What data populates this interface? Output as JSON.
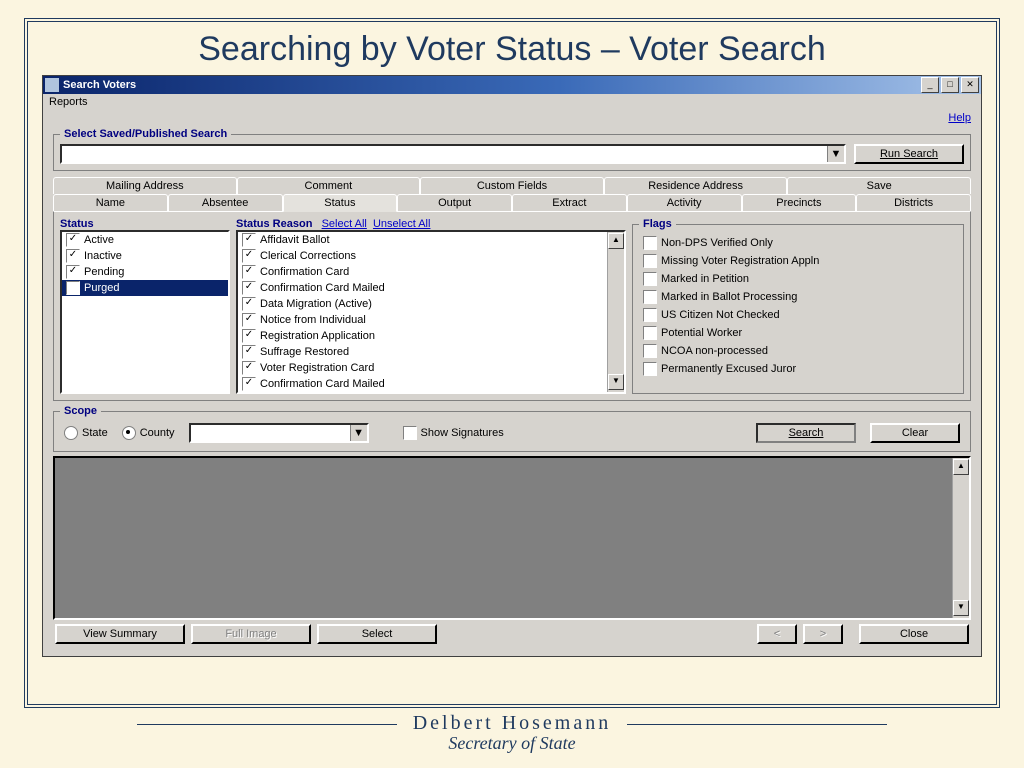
{
  "slide": {
    "title": "Searching by Voter Status – Voter Search"
  },
  "footer": {
    "name": "Delbert Hosemann",
    "office": "Secretary of State"
  },
  "window": {
    "title": "Search Voters",
    "menu": {
      "reports": "Reports"
    },
    "help": "Help",
    "saved_search": {
      "legend": "Select Saved/Published Search",
      "run": "Run Search"
    },
    "tabs_top": [
      "Mailing Address",
      "Comment",
      "Custom Fields",
      "Residence Address",
      "Save"
    ],
    "tabs_bottom": [
      "Name",
      "Absentee",
      "Status",
      "Output",
      "Extract",
      "Activity",
      "Precincts",
      "Districts"
    ],
    "active_tab": "Status",
    "status": {
      "header": "Status",
      "items": [
        {
          "label": "Active",
          "checked": true,
          "selected": false
        },
        {
          "label": "Inactive",
          "checked": true,
          "selected": false
        },
        {
          "label": "Pending",
          "checked": true,
          "selected": false
        },
        {
          "label": "Purged",
          "checked": true,
          "selected": true
        }
      ]
    },
    "status_reason": {
      "header": "Status Reason",
      "select_all": "Select All",
      "unselect_all": "Unselect All",
      "items": [
        "Affidavit Ballot",
        "Clerical Corrections",
        "Confirmation Card",
        "Confirmation Card Mailed",
        "Data Migration (Active)",
        "Notice from Individual",
        "Registration Application",
        "Suffrage Restored",
        "Voter Registration Card",
        "Confirmation Card Mailed"
      ]
    },
    "flags": {
      "legend": "Flags",
      "items": [
        "Non-DPS Verified Only",
        "Missing Voter Registration Appln",
        "Marked in Petition",
        "Marked in Ballot Processing",
        "US Citizen Not Checked",
        "Potential Worker",
        "NCOA non-processed",
        "Permanently Excused Juror"
      ]
    },
    "scope": {
      "legend": "Scope",
      "state": "State",
      "county": "County",
      "show_sigs": "Show Signatures",
      "search": "Search",
      "clear": "Clear"
    },
    "bottom": {
      "view_summary": "View Summary",
      "full_image": "Full Image",
      "select": "Select",
      "prev": "<",
      "next": ">",
      "close": "Close"
    }
  }
}
